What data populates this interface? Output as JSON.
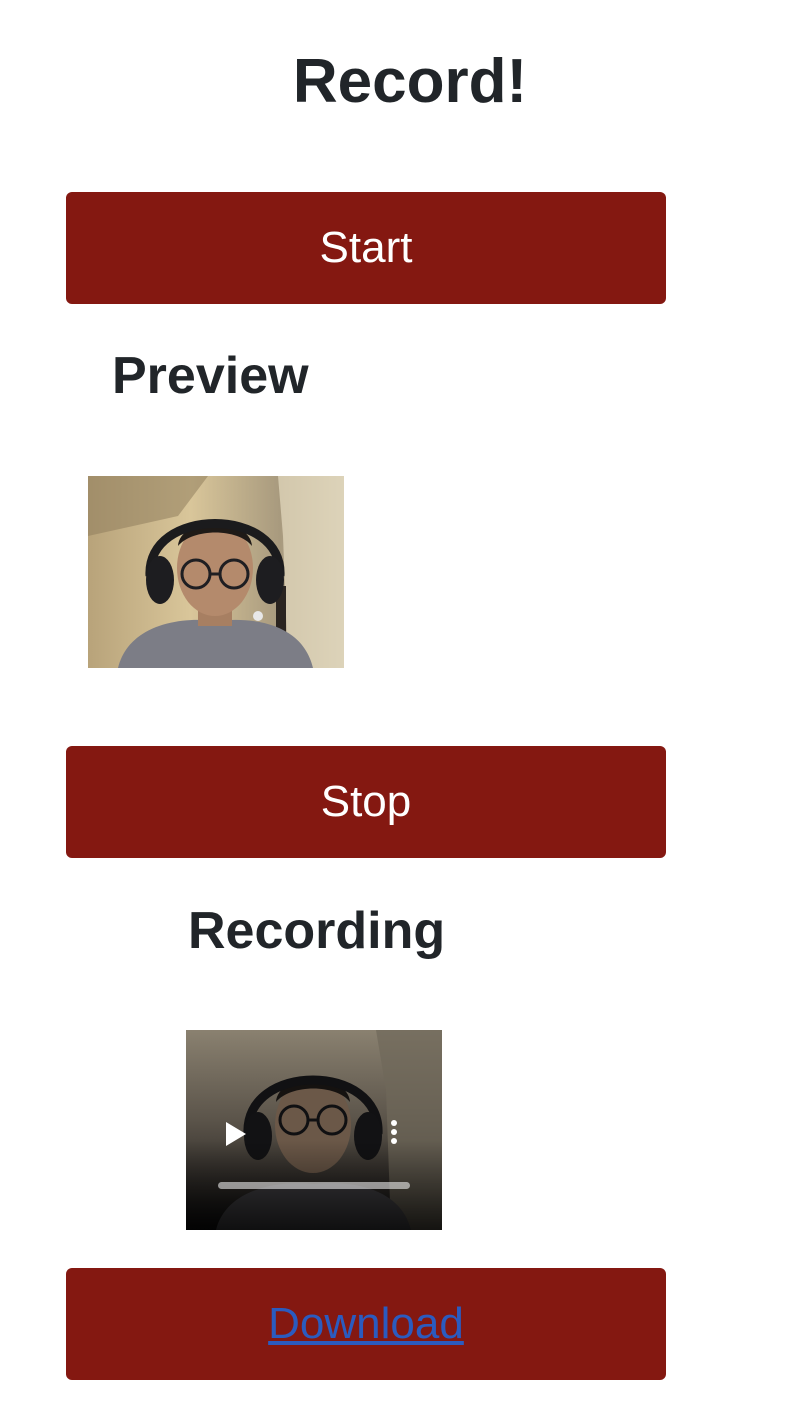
{
  "header": {
    "title": "Record!"
  },
  "buttons": {
    "start_label": "Start",
    "stop_label": "Stop",
    "download_label": "Download"
  },
  "sections": {
    "preview_heading": "Preview",
    "recording_heading": "Recording"
  },
  "colors": {
    "button_background": "#841811",
    "button_text": "#ffffff",
    "link": "#2b5bbf",
    "heading_text": "#212529"
  },
  "recording_player": {
    "icons": [
      "play-icon",
      "more-options-icon"
    ],
    "progress": 0
  }
}
